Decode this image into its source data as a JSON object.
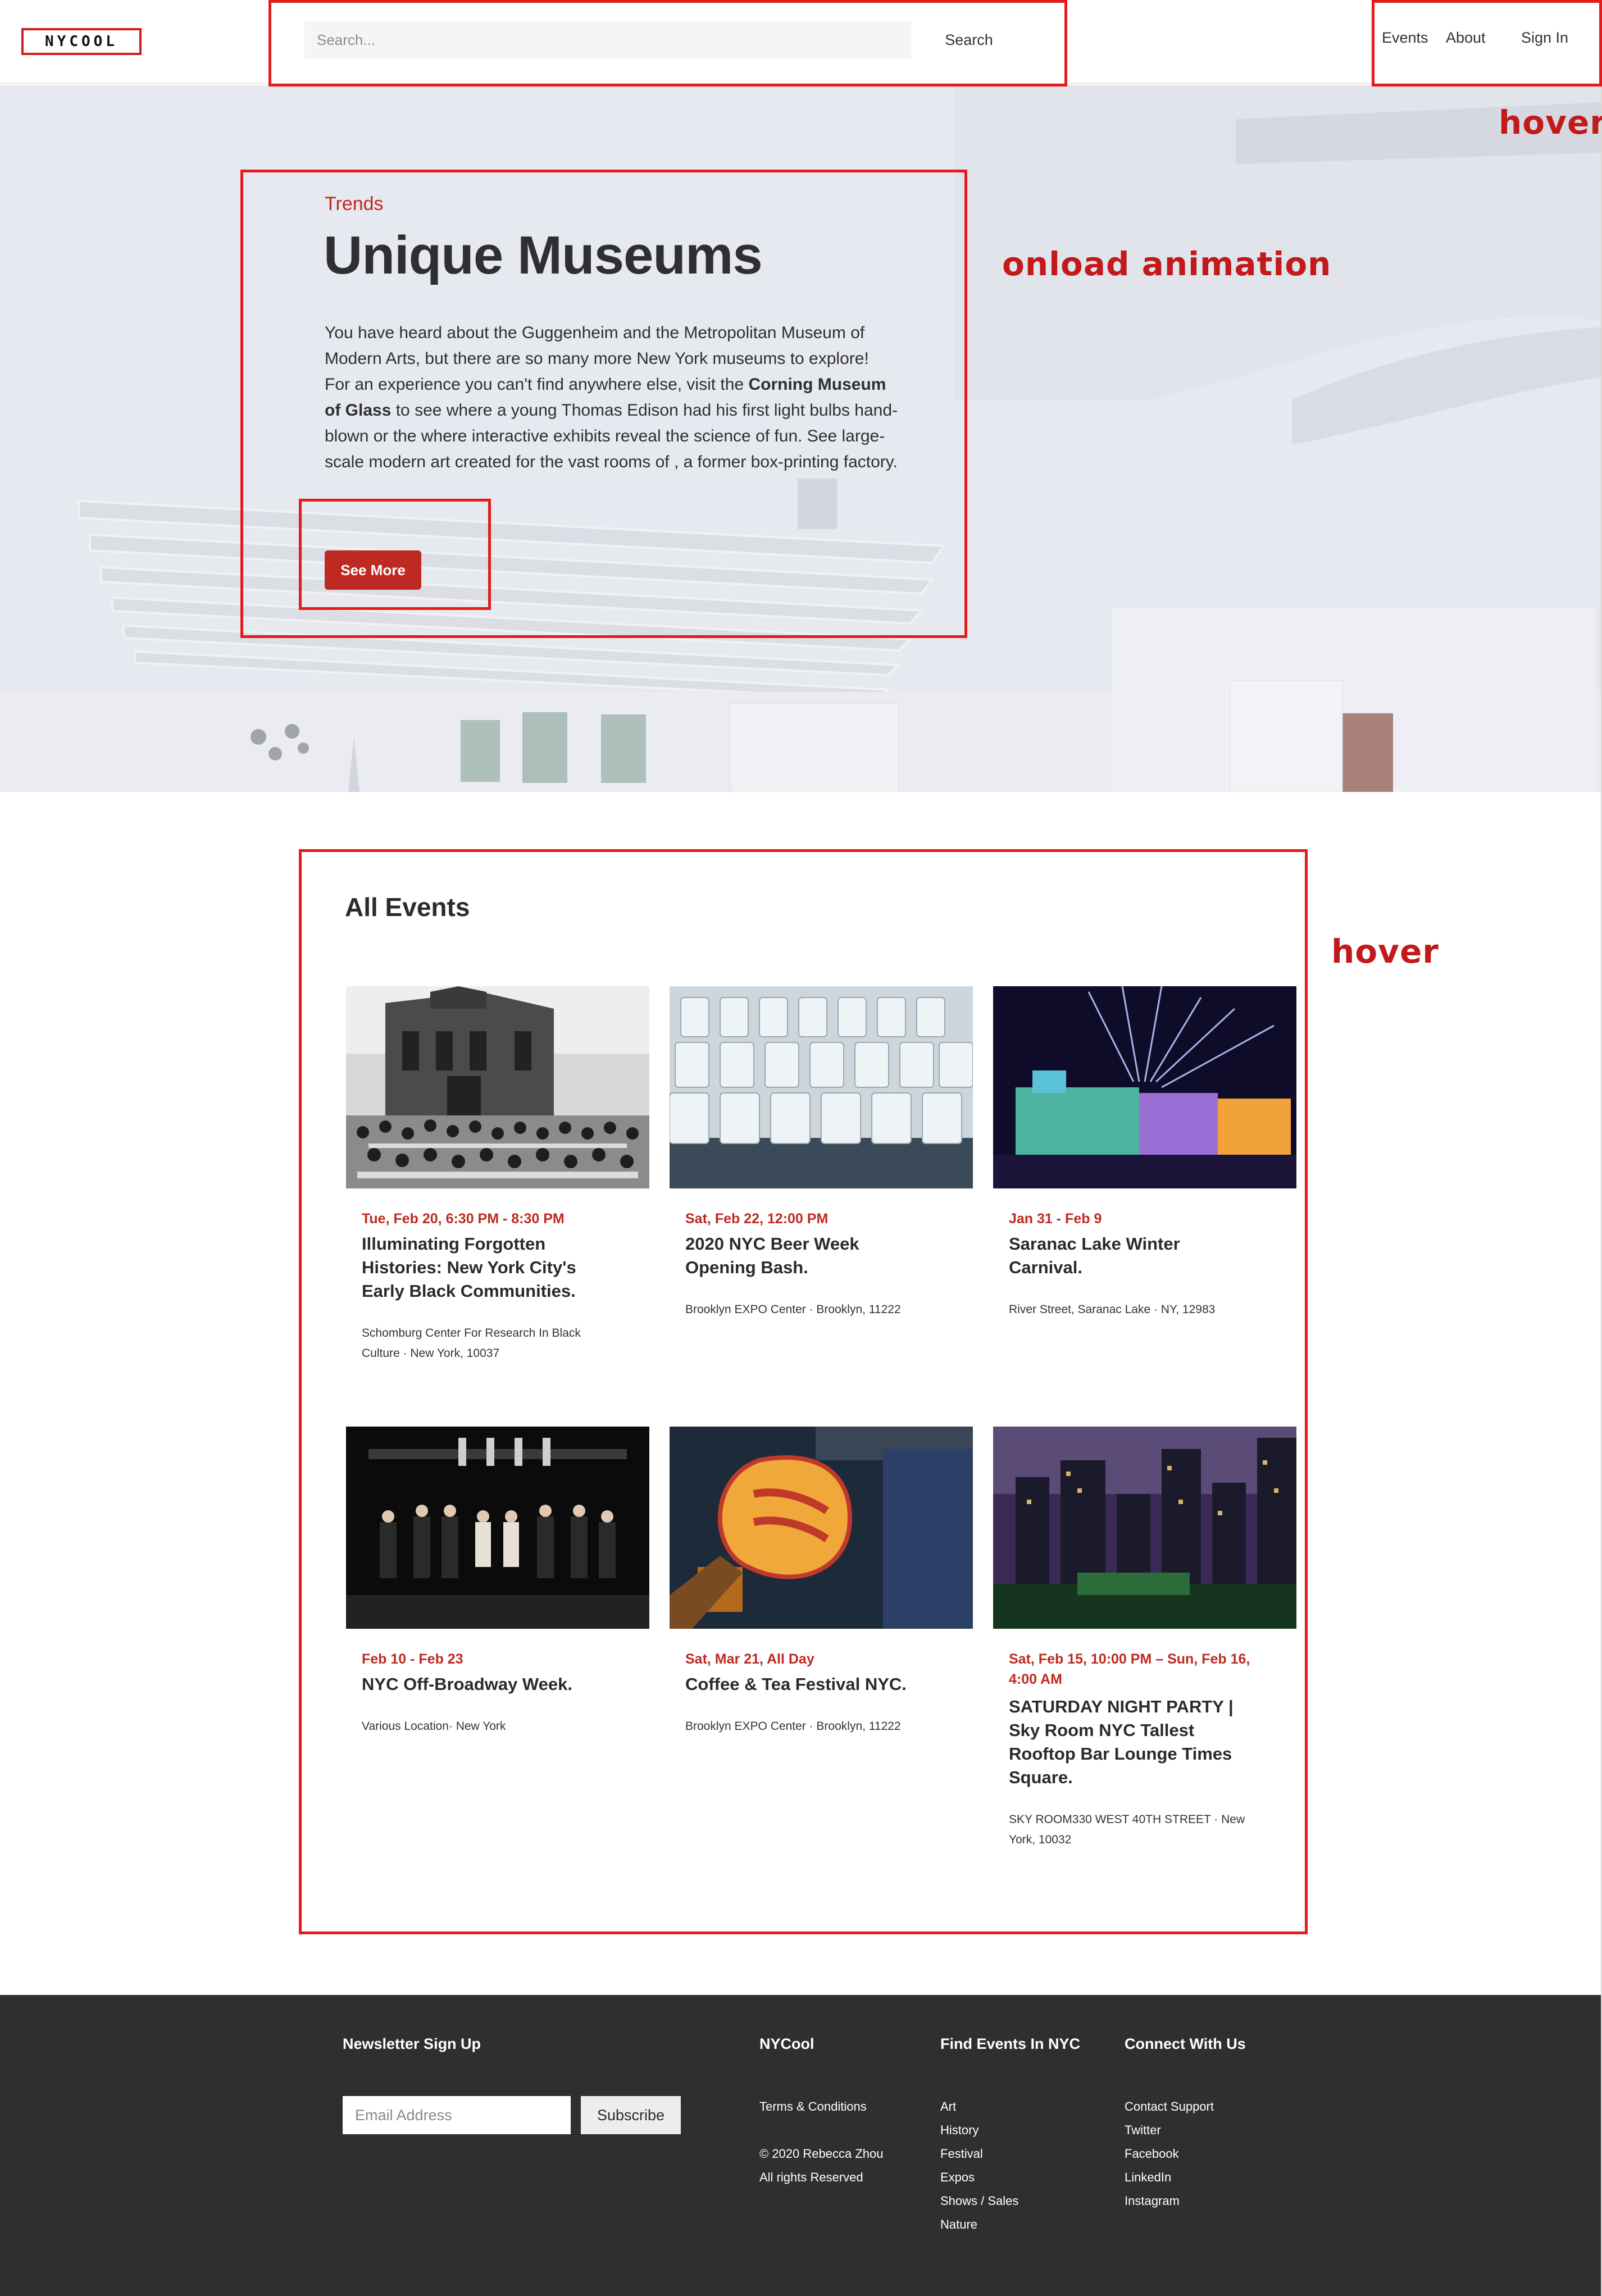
{
  "header": {
    "logo": "NYCOOL",
    "search_placeholder": "Search...",
    "search_label": "Search",
    "nav": [
      "Events",
      "About",
      "Sign In"
    ]
  },
  "annotations": {
    "hover_nav": "hover",
    "onload": "onload animation",
    "hover_events": "hover"
  },
  "hero": {
    "category": "Trends",
    "title": "Unique Museums",
    "body_pre": "You have heard about the Guggenheim and the Metropolitan Museum of Modern Arts, but there are so many more New York museums to explore! For an experience you can't find anywhere else, visit the ",
    "body_bold": "Corning Museum of Glass",
    "body_post": " to see where a young Thomas Edison had his first light bulbs hand-blown or the where interactive exhibits reveal the science of fun. See large-scale modern art created for the vast rooms of , a former box-printing factory.",
    "button": "See More"
  },
  "events": {
    "title": "All Events",
    "items": [
      {
        "date": "Tue, Feb 20, 6:30 PM - 8:30 PM",
        "name": "Illuminating Forgotten Histories: New York City's Early Black Communities.",
        "location": "Schomburg Center For Research In Black Culture · New York, 10037"
      },
      {
        "date": "Sat, Feb 22, 12:00 PM",
        "name": "2020 NYC Beer Week Opening Bash.",
        "location": "Brooklyn EXPO Center · Brooklyn, 11222"
      },
      {
        "date": "Jan 31 - Feb 9",
        "name": "Saranac Lake Winter Carnival.",
        "location": "River Street, Saranac Lake · NY, 12983"
      },
      {
        "date": "Feb 10 - Feb 23",
        "name": "NYC Off-Broadway Week.",
        "location": "Various Location· New York"
      },
      {
        "date": "Sat, Mar 21, All Day",
        "name": "Coffee & Tea Festival NYC.",
        "location": "Brooklyn EXPO Center · Brooklyn, 11222"
      },
      {
        "date": "Sat, Feb 15, 10:00 PM – Sun, Feb 16, 4:00 AM",
        "name": "SATURDAY NIGHT PARTY | Sky Room NYC Tallest Rooftop Bar Lounge Times Square.",
        "location": "SKY ROOM330 WEST 40TH STREET · New York, 10032"
      }
    ]
  },
  "footer": {
    "newsletter_title": "Newsletter Sign Up",
    "email_placeholder": "Email Address",
    "subscribe": "Subscribe",
    "col1_title": "NYCool",
    "col1_links": [
      "Terms & Conditions",
      "© 2020 Rebecca Zhou",
      "All rights Reserved"
    ],
    "col2_title": "Find Events In NYC",
    "col2_links": [
      "Art",
      "History",
      "Festival",
      "Expos",
      "Shows / Sales",
      "Nature"
    ],
    "col3_title": "Connect With Us",
    "col3_links": [
      "Contact Support",
      "Twitter",
      "Facebook",
      "LinkedIn",
      "Instagram"
    ]
  },
  "colors": {
    "accent": "#be2a21",
    "annotation": "#e31b1b",
    "footer_bg": "#2f2f31"
  }
}
